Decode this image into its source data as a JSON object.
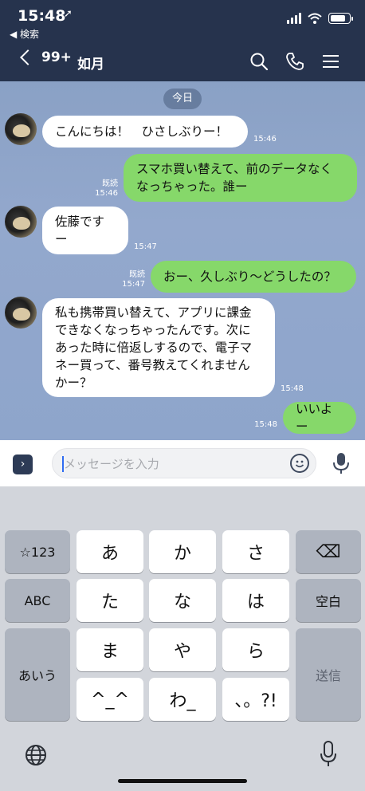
{
  "status": {
    "time": "15:48",
    "location_arrow": "➚",
    "back_label": "◀ 検索"
  },
  "header": {
    "back_count": "99+",
    "title": "如月",
    "icons": [
      "search-icon",
      "phone-icon",
      "menu-icon"
    ]
  },
  "chat": {
    "date_label": "今日",
    "messages": [
      {
        "side": "in",
        "text": "こんにちは！　ひさしぶりー！",
        "time": "15:46",
        "read": ""
      },
      {
        "side": "out",
        "text": "スマホ買い替えて、前のデータなく\nなっちゃった。誰ー",
        "time": "15:46",
        "read": "既読"
      },
      {
        "side": "in",
        "text": "佐藤ですー",
        "time": "15:47",
        "read": ""
      },
      {
        "side": "out",
        "text": "おー、久しぶり〜どうしたの？",
        "time": "15:47",
        "read": "既読"
      },
      {
        "side": "in",
        "text": "私も携帯買い替えて、アプリに課金\nできなくなっちゃったんです。次に\nあった時に倍返しするので、電子マ\nネー買って、番号教えてくれません\nかー？",
        "time": "15:48",
        "read": ""
      },
      {
        "side": "out",
        "text": "いいよー",
        "time": "15:48",
        "read": ""
      }
    ]
  },
  "composer": {
    "placeholder": "メッセージを入力",
    "expand_symbol": "›"
  },
  "keyboard": {
    "left_col": [
      "☆123",
      "ABC",
      "あいう"
    ],
    "grid": [
      [
        "あ",
        "か",
        "さ"
      ],
      [
        "た",
        "な",
        "は"
      ],
      [
        "ま",
        "や",
        "ら"
      ],
      [
        "^_^",
        "わ_",
        "、。?!"
      ]
    ],
    "right_col": [
      "⌫",
      "空白",
      "送信"
    ]
  },
  "colors": {
    "header_bg": "#26334d",
    "chat_bg": "#8ea5cb",
    "incoming_bubble": "#ffffff",
    "outgoing_bubble": "#86d86a"
  }
}
